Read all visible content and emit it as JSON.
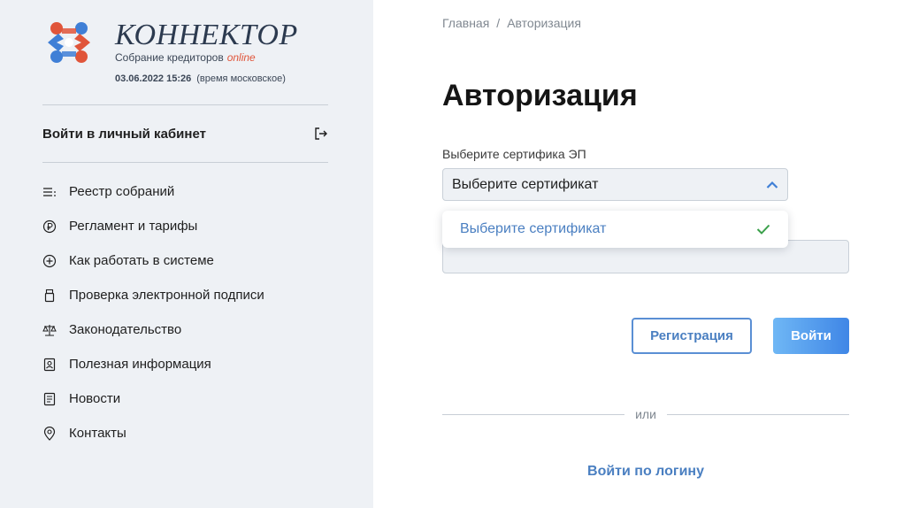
{
  "brand": {
    "name": "КОННЕКТОР",
    "subtitle": "Собрание кредиторов",
    "subtitle_accent": "online",
    "datetime": "03.06.2022 15:26",
    "timezone_note": "(время московское)",
    "colors": {
      "orange": "#e0553a",
      "blue": "#3f7fd6",
      "dark": "#2c3a4f"
    }
  },
  "sidebar": {
    "login_label": "Войти в личный кабинет",
    "login_icon": "logout-arrow-icon",
    "items": [
      {
        "label": "Реестр собраний",
        "icon": "list-icon"
      },
      {
        "label": "Регламент и тарифы",
        "icon": "ruble-icon"
      },
      {
        "label": "Как работать в системе",
        "icon": "plus-circle-icon"
      },
      {
        "label": "Проверка электронной подписи",
        "icon": "usb-token-icon"
      },
      {
        "label": "Законодательство",
        "icon": "scales-icon"
      },
      {
        "label": "Полезная информация",
        "icon": "id-card-icon"
      },
      {
        "label": "Новости",
        "icon": "document-icon"
      },
      {
        "label": "Контакты",
        "icon": "location-pin-icon"
      }
    ]
  },
  "breadcrumb": {
    "home": "Главная",
    "separator": "/",
    "current": "Авторизация"
  },
  "page": {
    "title": "Авторизация",
    "cert_label": "Выберите сертифика ЭП",
    "cert_selected": "Выберите сертификат",
    "dropdown_options": [
      {
        "label": "Выберите сертификат",
        "selected": true
      }
    ],
    "register_button": "Регистрация",
    "login_button": "Войти",
    "or_text": "или",
    "login_by_password": "Войти по логину"
  },
  "accent_color": "#4a7fc1"
}
